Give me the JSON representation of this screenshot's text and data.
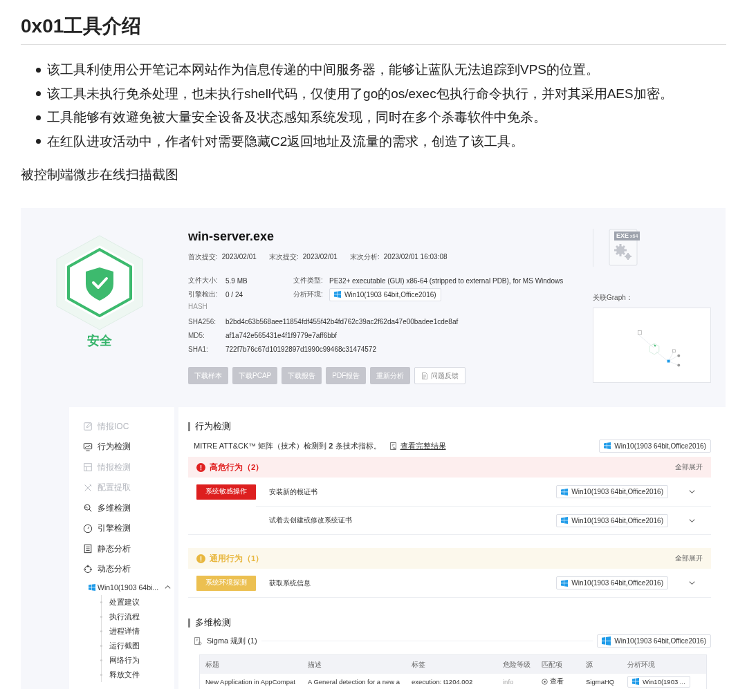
{
  "article": {
    "heading": "0x01工具介绍",
    "bullets": [
      "该工具利使用公开笔记本网站作为信息传递的中间服务器，能够让蓝队无法追踪到VPS的位置。",
      "该工具未执行免杀处理，也未执行shell代码，仅使用了go的os/exec包执行命令执行，并对其采用AES加密。",
      "工具能够有效避免被大量安全设备及状态感知系统发现，同时在多个杀毒软件中免杀。",
      "在红队进攻活动中，作者针对需要隐藏C2返回地址及流量的需求，创造了该工具。"
    ],
    "caption": "被控制端微步在线扫描截图"
  },
  "report": {
    "file_name": "win-server.exe",
    "verdict": "安全",
    "dates": [
      {
        "label": "首次提交:",
        "value": "2023/02/01"
      },
      {
        "label": "末次提交:",
        "value": "2023/02/01"
      },
      {
        "label": "末次分析:",
        "value": "2023/02/01 16:03:08"
      }
    ],
    "info": [
      {
        "label": "文件大小:",
        "value": "5.9 MB",
        "kind": "text"
      },
      {
        "label": "文件类型:",
        "value": "PE32+ executable (GUI) x86-64 (stripped to external PDB), for MS Windows",
        "kind": "text"
      },
      {
        "label": "引擎检出:",
        "value": "0 / 24",
        "kind": "text"
      },
      {
        "label": "分析环境:",
        "value": "Win10(1903 64bit,Office2016)",
        "kind": "env"
      }
    ],
    "hash_title": "HASH",
    "hashes": [
      {
        "label": "SHA256:",
        "value": "b2bd4c63b568aee11854fdf455f42b4fd762c39ac2f62da47e00badee1cde8af"
      },
      {
        "label": "MD5:",
        "value": "af1a742e565431e4f1f9779e7aff6bbf"
      },
      {
        "label": "SHA1:",
        "value": "722f7b76c67d10192897d1990c99468c31474572"
      }
    ],
    "actions": [
      {
        "label": "下载样本",
        "kind": "filled"
      },
      {
        "label": "下载PCAP",
        "kind": "filled"
      },
      {
        "label": "下载报告",
        "kind": "filled"
      },
      {
        "label": "PDF报告",
        "kind": "filled"
      },
      {
        "label": "重新分析",
        "kind": "filled"
      },
      {
        "label": "问题反馈",
        "kind": "outline"
      }
    ],
    "file_type": "EXE",
    "file_arch": "x64",
    "graph_label": "关联Graph："
  },
  "sidebar": {
    "items": [
      {
        "label": "情报IOC",
        "disabled": true
      },
      {
        "label": "行为检测",
        "disabled": false
      },
      {
        "label": "情报检测",
        "disabled": true
      },
      {
        "label": "配置提取",
        "disabled": true
      },
      {
        "label": "多维检测",
        "disabled": false
      },
      {
        "label": "引擎检测",
        "disabled": false
      },
      {
        "label": "静态分析",
        "disabled": false
      },
      {
        "label": "动态分析",
        "disabled": false
      }
    ],
    "env": {
      "label": "Win10(1903 64bi...",
      "expanded": true,
      "children": [
        {
          "label": "处置建议"
        },
        {
          "label": "执行流程"
        },
        {
          "label": "进程详情"
        },
        {
          "label": "运行截图"
        },
        {
          "label": "网络行为"
        },
        {
          "label": "释放文件"
        }
      ]
    }
  },
  "behavior": {
    "title": "行为检测",
    "summary": "MITRE ATT&CK™ 矩阵（技术）检测到 **2** 条技术指标。",
    "link": "查看完整结果",
    "env": "Win10(1903 64bit,Office2016)",
    "groups": [
      {
        "title": "高危行为（2）",
        "kind": "high",
        "expand": "全部展开",
        "items": [
          {
            "tag": "系统敏感操作",
            "text": "安装新的根证书",
            "env": "Win10(1903 64bit,Office2016)",
            "expanded": false
          },
          {
            "text": "试着去创建或修改系统证书",
            "env": "Win10(1903 64bit,Office2016)",
            "expanded": false
          }
        ]
      },
      {
        "title": "通用行为（1）",
        "kind": "general",
        "expand": "全部展开",
        "items": [
          {
            "tag": "系统环境探测",
            "text": "获取系统信息",
            "env": "Win10(1903 64bit,Office2016)",
            "expanded": false
          }
        ]
      }
    ]
  },
  "multi": {
    "title": "多维检测",
    "sigma": "Sigma 规则 (1)",
    "env": "Win10(1903 64bit,Office2016)",
    "table": {
      "columns": [
        "标题",
        "描述",
        "标签",
        "危险等级",
        "匹配项",
        "源",
        "分析环境"
      ],
      "rows": [
        [
          "New Application in AppCompat",
          "A General detection for a new a",
          "execution: t1204.002",
          "info",
          "查看",
          "SigmaHQ",
          "Win10(1903 ..."
        ]
      ]
    }
  }
}
